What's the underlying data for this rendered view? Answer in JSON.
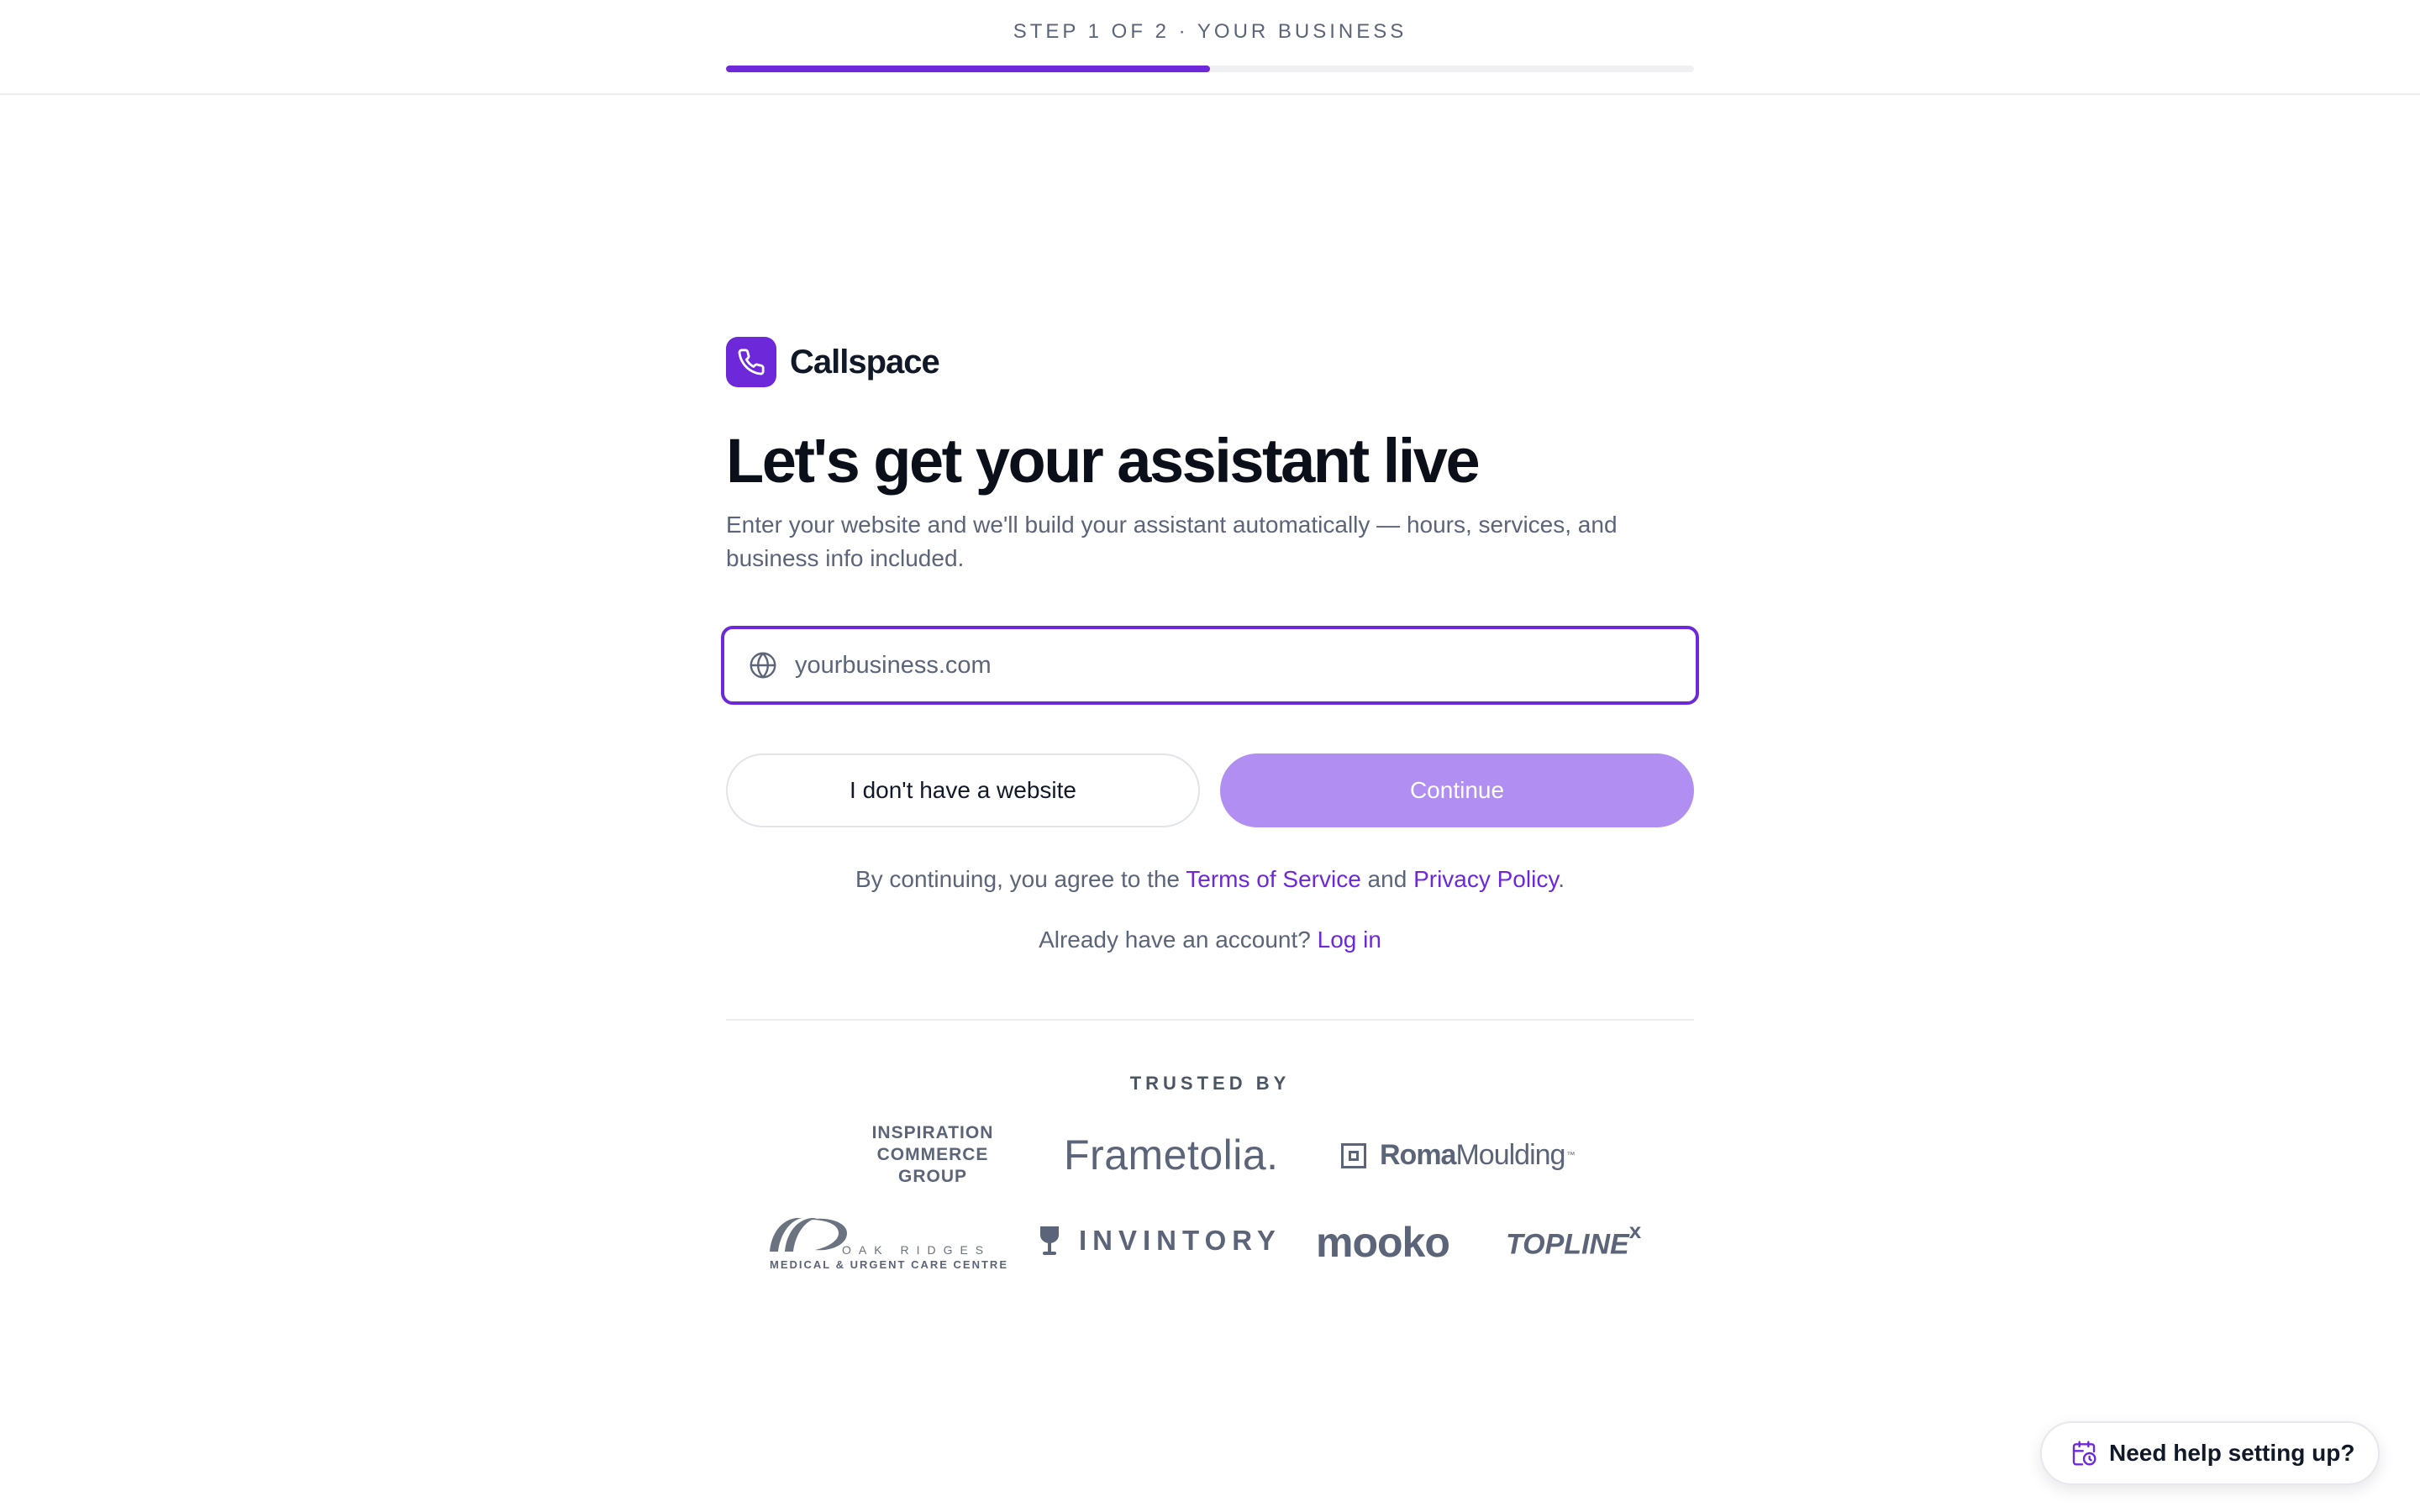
{
  "header": {
    "step_label": "STEP 1 OF 2 · YOUR BUSINESS",
    "progress_fraction": 0.5
  },
  "brand": {
    "name": "Callspace",
    "icon": "phone-icon",
    "color": "#6d28d9"
  },
  "hero": {
    "headline": "Let's get your assistant live",
    "subtitle": "Enter your website and we'll build your assistant automatically — hours, services, and business info included."
  },
  "website_field": {
    "icon": "globe-icon",
    "value": "",
    "placeholder": "yourbusiness.com"
  },
  "actions": {
    "no_website_label": "I don't have a website",
    "continue_label": "Continue"
  },
  "legal": {
    "prefix": "By continuing, you agree to the ",
    "terms_label": "Terms of Service",
    "middle": " and ",
    "privacy_label": "Privacy Policy",
    "suffix": "."
  },
  "login": {
    "prompt": "Already have an account? ",
    "link_label": "Log in"
  },
  "trusted": {
    "label": "TRUSTED BY",
    "logos": {
      "icg": [
        "INSPIRATION",
        "COMMERCE",
        "GROUP"
      ],
      "frametolia": "Frametolia.",
      "roma_bold": "Roma",
      "roma_light": "Moulding",
      "roma_tm": "™",
      "oak_top": "OAK RIDGES",
      "oak_bottom": "MEDICAL & URGENT CARE CENTRE",
      "invintory": "INVINTORY",
      "mooko": "mooko",
      "topline": "TOPLINE",
      "topline_x": "x"
    }
  },
  "help": {
    "icon": "calendar-clock-icon",
    "label": "Need help setting up?"
  },
  "colors": {
    "accent": "#6d28d9",
    "continue_disabled": "#b08ef2",
    "muted_text": "#5b6478"
  }
}
